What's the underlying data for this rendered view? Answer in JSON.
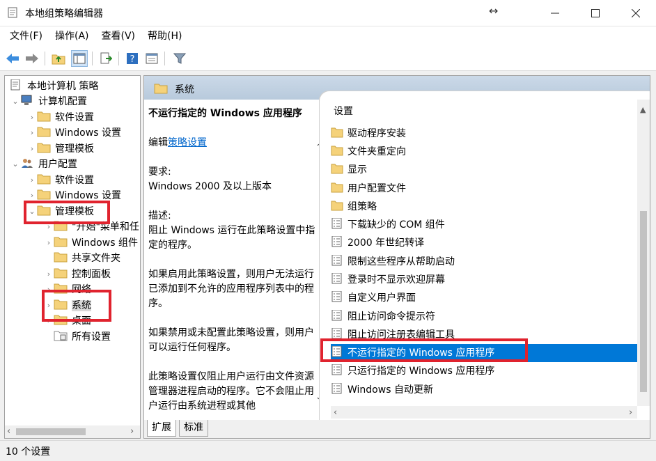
{
  "window": {
    "title": "本地组策略编辑器"
  },
  "menu": [
    "文件(F)",
    "操作(A)",
    "查看(V)",
    "帮助(H)"
  ],
  "tree": {
    "root": "本地计算机 策略",
    "items": [
      {
        "label": "计算机配置"
      },
      {
        "label": "软件设置"
      },
      {
        "label": "Windows 设置"
      },
      {
        "label": "管理模板"
      },
      {
        "label": "用户配置"
      },
      {
        "label": "软件设置"
      },
      {
        "label": "Windows 设置"
      },
      {
        "label": "管理模板"
      },
      {
        "label": "\"开始\"菜单和任"
      },
      {
        "label": "Windows 组件"
      },
      {
        "label": "共享文件夹"
      },
      {
        "label": "控制面板"
      },
      {
        "label": "网络"
      },
      {
        "label": "系统"
      },
      {
        "label": "桌面"
      },
      {
        "label": "所有设置"
      }
    ]
  },
  "header": {
    "title": "系统"
  },
  "description": {
    "title": "不运行指定的 Windows 应用程序",
    "edit_prefix": "编辑",
    "edit_link": "策略设置",
    "requirements_label": "要求:",
    "requirements_value": "Windows 2000 及以上版本",
    "description_label": "描述:",
    "description_text": "阻止 Windows 运行在此策略设置中指定的程序。",
    "enabled_text": "如果启用此策略设置，则用户无法运行已添加到不允许的应用程序列表中的程序。",
    "disabled_text": "如果禁用或未配置此策略设置，则用户可以运行任何程序。",
    "note_text": "此策略设置仅阻止用户运行由文件资源管理器进程启动的程序。它不会阻止用户运行由系统进程或其他"
  },
  "list": {
    "header": "设置",
    "items": [
      {
        "label": "驱动程序安装",
        "type": "folder"
      },
      {
        "label": "文件夹重定向",
        "type": "folder"
      },
      {
        "label": "显示",
        "type": "folder"
      },
      {
        "label": "用户配置文件",
        "type": "folder"
      },
      {
        "label": "组策略",
        "type": "folder"
      },
      {
        "label": "下载缺少的 COM 组件",
        "type": "setting"
      },
      {
        "label": "2000 年世纪转译",
        "type": "setting"
      },
      {
        "label": "限制这些程序从帮助启动",
        "type": "setting"
      },
      {
        "label": "登录时不显示欢迎屏幕",
        "type": "setting"
      },
      {
        "label": "自定义用户界面",
        "type": "setting"
      },
      {
        "label": "阻止访问命令提示符",
        "type": "setting"
      },
      {
        "label": "阻止访问注册表编辑工具",
        "type": "setting"
      },
      {
        "label": "不运行指定的 Windows 应用程序",
        "type": "setting",
        "selected": true
      },
      {
        "label": "只运行指定的 Windows 应用程序",
        "type": "setting"
      },
      {
        "label": "Windows 自动更新",
        "type": "setting"
      }
    ]
  },
  "tabs": [
    "扩展",
    "标准"
  ],
  "status": {
    "text": "10 个设置"
  },
  "colors": {
    "selection": "#0078d7",
    "highlight": "#e0232e",
    "link": "#0066cc",
    "folder": "#f5d27a"
  }
}
